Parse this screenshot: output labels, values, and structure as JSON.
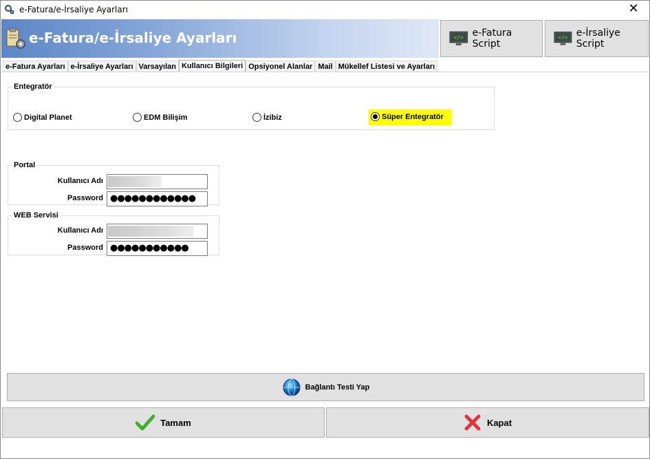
{
  "window": {
    "title": "e-Fatura/e-İrsaliye Ayarları",
    "close_glyph": "✕"
  },
  "header": {
    "title": "e-Fatura/e-İrsaliye Ayarları",
    "icon": "clipboard-gear-icon",
    "buttons": [
      {
        "label": "e-Fatura Script",
        "icon": "code-monitor-icon"
      },
      {
        "label": "e-İrsaliye Script",
        "icon": "code-monitor-icon"
      }
    ]
  },
  "tabs": [
    {
      "label": "e-Fatura Ayarları",
      "active": false
    },
    {
      "label": "e-İrsaliye Ayarları",
      "active": false
    },
    {
      "label": "Varsayılan",
      "active": false
    },
    {
      "label": "Kullanıcı Bilgileri",
      "active": true
    },
    {
      "label": "Opsiyonel Alanlar",
      "active": false
    },
    {
      "label": "Mail",
      "active": false
    },
    {
      "label": "Mükellef Listesi ve Ayarları",
      "active": false
    }
  ],
  "entegrator": {
    "legend": "Entegratör",
    "options": [
      {
        "label": "Digital Planet",
        "selected": false
      },
      {
        "label": "EDM Bilişim",
        "selected": false
      },
      {
        "label": "İzibiz",
        "selected": false
      },
      {
        "label": "Süper Entegratör",
        "selected": true
      }
    ],
    "highlight_color": "#ffff00"
  },
  "portal": {
    "legend": "Portal",
    "username_label": "Kullanıcı Adı",
    "password_label": "Password",
    "password_value": "●●●●●●●●●●●●"
  },
  "web_servisi": {
    "legend": "WEB Servisi",
    "username_label": "Kullanıcı Adı",
    "password_label": "Password",
    "password_value": "●●●●●●●●●●●"
  },
  "actions": {
    "test_label": "Bağlantı Testi Yap",
    "test_icon": "globe-icon",
    "ok_label": "Tamam",
    "ok_icon": "check-icon",
    "close_label": "Kapat",
    "close_icon": "x-icon"
  },
  "colors": {
    "banner_start": "#5b86c6",
    "banner_end": "#dfe8f6",
    "button_face": "#e1e1e1",
    "ok_green": "#3fae2a",
    "close_red": "#e0353d"
  }
}
